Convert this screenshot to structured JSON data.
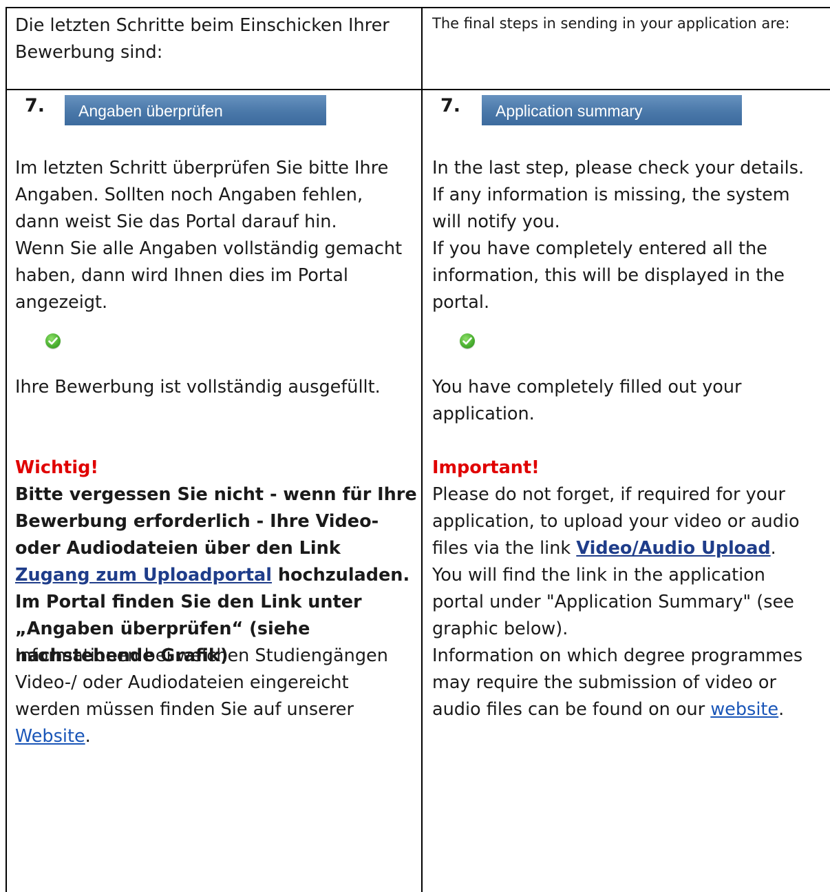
{
  "intro": {
    "de": "Die letzten Schritte beim Einschicken Ihrer Bewerbung sind:",
    "en": "The final steps in sending in your application are:"
  },
  "step": {
    "number": "7.",
    "de_label": "Angaben überprüfen",
    "en_label": "Application summary"
  },
  "check_de": {
    "line1": "Im letzten Schritt überprüfen Sie bitte Ihre",
    "line2": "Angaben. Sollten noch Angaben fehlen,",
    "line3": "dann weist Sie das Portal darauf hin.",
    "line4": "Wenn Sie alle Angaben vollständig gemacht",
    "line5": "haben, dann wird Ihnen dies im Portal",
    "line6": "angezeigt."
  },
  "check_en": {
    "line1": "In the last step, please check your details.",
    "line2": "If any information is missing, the system",
    "line3": "will notify you.",
    "line4": "If you have completely entered all the",
    "line5": "information, this will be displayed in the",
    "line6": "portal."
  },
  "complete": {
    "de": "Ihre Bewerbung ist vollständig ausgefüllt.",
    "en_line1": "You have completely filled out your",
    "en_line2": "application."
  },
  "important_de": {
    "heading": "Wichtig!",
    "line1": "Bitte vergessen Sie nicht - wenn für Ihre",
    "line2": "Bewerbung erforderlich - Ihre Video-",
    "line3": "oder Audiodateien über den Link",
    "link": "Zugang zum Uploadportal",
    "line4_after": " hochzuladen.",
    "line5": "Im Portal finden Sie den Link unter",
    "line6": "„Angaben überprüfen“ (siehe",
    "line7": "nachstehende Grafik)"
  },
  "important_en": {
    "heading": "Important!",
    "line1": "Please do not forget, if required for your",
    "line2": "application, to upload your video or audio",
    "line3_before": "files via the link ",
    "link": "Video/Audio Upload",
    "line3_after": ".",
    "line4": "You will find the link in the application",
    "line5": "portal under \"Application Summary\" (see",
    "line6": "graphic below)."
  },
  "info_de": {
    "line1": "Informationen bei welchen Studiengängen",
    "line2": "Video-/ oder Audiodateien eingereicht",
    "line3": "werden müssen finden Sie auf unserer",
    "link": "Website",
    "after": "."
  },
  "info_en": {
    "line1": "Information on which degree programmes",
    "line2": "may require the submission of video or",
    "line3_before": "audio files can be found on our ",
    "link": "website",
    "after": "."
  },
  "colors": {
    "important": "#e00000",
    "link": "#1a56b8",
    "step_bar": "#4a78a9",
    "check": "#4cb132"
  }
}
